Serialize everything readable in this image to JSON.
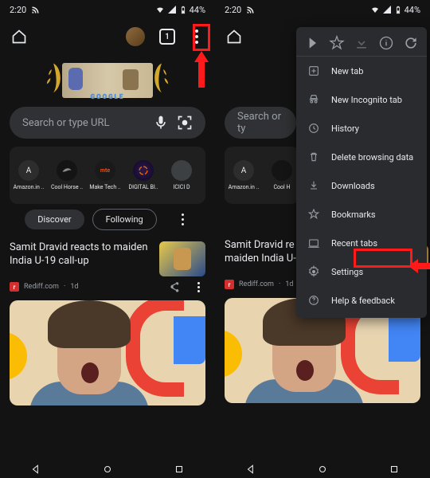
{
  "status": {
    "time": "2:20",
    "battery": "44%"
  },
  "topbar": {
    "tabcount": "1"
  },
  "doodle": "GOOGLE",
  "search": {
    "placeholder": "Search or type URL"
  },
  "tiles": [
    {
      "label": "Amazon.in ..",
      "initial": "A"
    },
    {
      "label": "Cool Horse ..",
      "initial": ""
    },
    {
      "label": "Make Tech ..",
      "initial": "mte"
    },
    {
      "label": "DIGITAL BI..",
      "initial": ""
    },
    {
      "label": "ICICI D",
      "initial": ""
    }
  ],
  "feed": {
    "discover": "Discover",
    "following": "Following"
  },
  "article": {
    "title": "Samit Dravid reacts to maiden India U-19 call-up",
    "source": "Rediff.com",
    "age": "1d",
    "src_initial": "r"
  },
  "menu": {
    "newtab": "New tab",
    "incognito": "New Incognito tab",
    "history": "History",
    "delete": "Delete browsing data",
    "downloads": "Downloads",
    "bookmarks": "Bookmarks",
    "recent": "Recent tabs",
    "settings": "Settings",
    "help": "Help & feedback"
  },
  "article2_partial": "Samit Dravid re\nmaiden India U-",
  "tiles2": [
    {
      "label": "Amazon.in ..",
      "initial": "A"
    },
    {
      "label": "Cool H",
      "initial": ""
    }
  ]
}
